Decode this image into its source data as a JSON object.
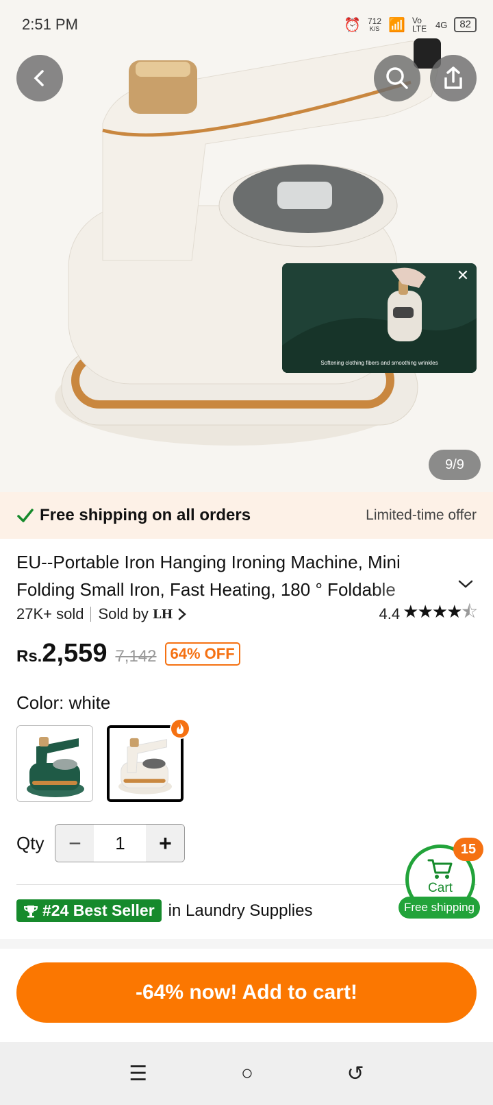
{
  "status_bar": {
    "time": "2:51 PM",
    "net_speed": "712",
    "net_unit": "K/S",
    "volte": "Vo LTE",
    "network": "4G",
    "battery": "82"
  },
  "hero": {
    "image_counter": "9/9",
    "video_caption": "Softening clothing fibers and smoothing wrinkles"
  },
  "shipping": {
    "left_text": "Free shipping on all orders",
    "right_text": "Limited-time offer"
  },
  "product": {
    "title": "EU--Portable Iron Hanging Ironing Machine, Mini Folding Small Iron, Fast Heating, 180 ° Foldable",
    "sold": "27K+ sold",
    "sold_by_label": "Sold by",
    "seller": "LH",
    "rating": "4.4",
    "stars": "★★★★",
    "half_star": "⯪"
  },
  "price": {
    "currency": "Rs.",
    "current": "2,559",
    "original": "7,142",
    "discount": "64% OFF"
  },
  "color": {
    "label": "Color: white"
  },
  "qty": {
    "label": "Qty",
    "value": "1",
    "minus": "−",
    "plus": "+"
  },
  "best_seller": {
    "badge": "#24 Best Seller",
    "category": "in Laundry Supplies"
  },
  "cart": {
    "label": "Cart",
    "count": "15",
    "free_shipping": "Free shipping"
  },
  "cta": {
    "label": "-64% now! Add to cart!"
  },
  "nav": {
    "menu": "☰",
    "home": "○",
    "back": "↺"
  },
  "colors": {
    "accent_orange": "#fb7701",
    "green": "#22a33a"
  }
}
